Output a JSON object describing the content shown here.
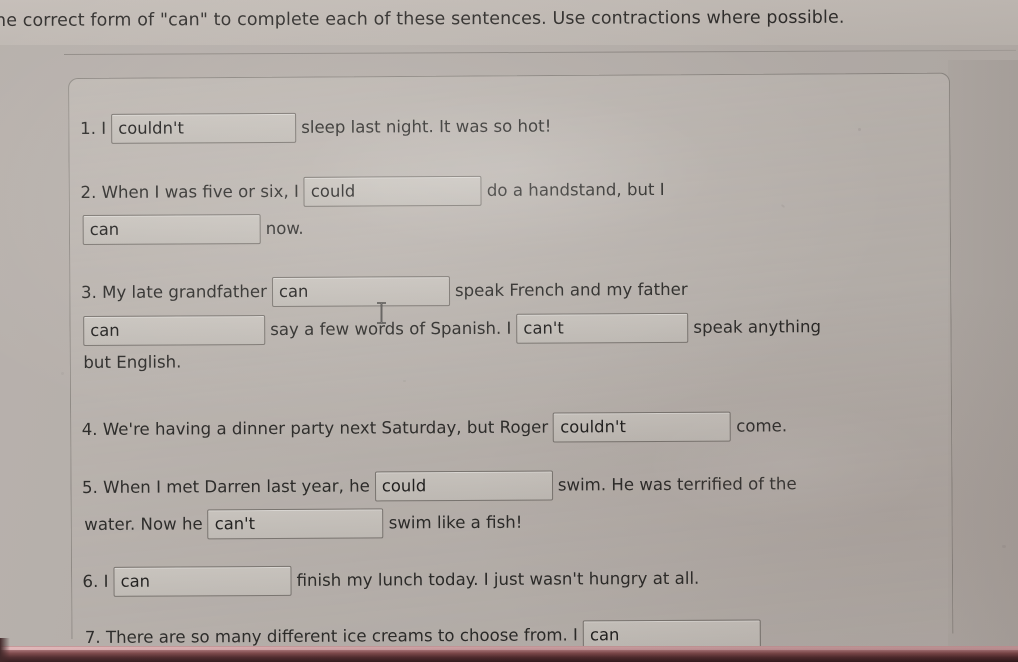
{
  "header": {
    "instruction": "he correct form of \"can\" to complete each of these sentences. Use contractions where possible."
  },
  "exercise": {
    "questions": [
      {
        "number": "1.",
        "segments": [
          {
            "type": "text",
            "value": "1. I"
          },
          {
            "type": "input",
            "value": "couldn't",
            "placeholder": ""
          },
          {
            "type": "text",
            "value": "sleep last night. It was so hot!"
          }
        ]
      },
      {
        "number": "2.",
        "segments": [
          {
            "type": "text",
            "value": "2. When I was five or six, I"
          },
          {
            "type": "input",
            "value": "could",
            "placeholder": ""
          },
          {
            "type": "text",
            "value": "do a handstand, but I"
          }
        ],
        "segments2": [
          {
            "type": "input",
            "value": "can",
            "placeholder": ""
          },
          {
            "type": "text",
            "value": "now."
          }
        ]
      },
      {
        "number": "3.",
        "segments": [
          {
            "type": "text",
            "value": "3. My late grandfather"
          },
          {
            "type": "input",
            "value": "can",
            "placeholder": ""
          },
          {
            "type": "text",
            "value": "speak French and my father"
          }
        ],
        "segments2": [
          {
            "type": "input",
            "value": "can",
            "placeholder": ""
          },
          {
            "type": "text",
            "value": "say a few words of Spanish. I"
          },
          {
            "type": "input",
            "value": "can't",
            "placeholder": ""
          },
          {
            "type": "text",
            "value": "speak anything"
          }
        ],
        "segments3": [
          {
            "type": "text",
            "value": "but English."
          }
        ]
      },
      {
        "number": "4.",
        "segments": [
          {
            "type": "text",
            "value": "4. We're having a dinner party next Saturday, but Roger"
          },
          {
            "type": "input",
            "value": "couldn't",
            "placeholder": ""
          },
          {
            "type": "text",
            "value": "come."
          }
        ]
      },
      {
        "number": "5.",
        "segments": [
          {
            "type": "text",
            "value": "5. When I met Darren last year, he"
          },
          {
            "type": "input",
            "value": "could",
            "placeholder": ""
          },
          {
            "type": "text",
            "value": "swim. He was terrified of the"
          }
        ],
        "segments2": [
          {
            "type": "text",
            "value": "water. Now he"
          },
          {
            "type": "input",
            "value": "can't",
            "placeholder": ""
          },
          {
            "type": "text",
            "value": "swim like a fish!"
          }
        ]
      },
      {
        "number": "6.",
        "segments": [
          {
            "type": "text",
            "value": "6. I"
          },
          {
            "type": "input",
            "value": "can",
            "placeholder": ""
          },
          {
            "type": "text",
            "value": "finish my lunch today. I just wasn't hungry at all."
          }
        ]
      },
      {
        "number": "7.",
        "segments": [
          {
            "type": "text",
            "value": "7. There are so many different ice creams to choose from. I"
          },
          {
            "type": "input",
            "value": "can",
            "placeholder": ""
          }
        ]
      }
    ]
  },
  "cursor": {
    "icon": "text-ibeam-cursor"
  },
  "colors": {
    "page_background": "#b4ada8",
    "card_background": "#bdb7b1",
    "input_background": "#c5c0ba",
    "input_border": "#77726d",
    "text": "#262523",
    "bezel_accent": "#7a4446"
  }
}
